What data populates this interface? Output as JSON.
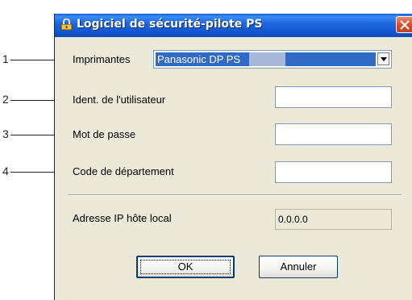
{
  "window": {
    "title": "Logiciel de sécurité-pilote PS"
  },
  "callouts": [
    "1",
    "2",
    "3",
    "4"
  ],
  "form": {
    "printers_label": "Imprimantes",
    "printer_value": "Panasonic DP          PS",
    "user_id_label": "Ident. de l'utilisateur",
    "user_id_value": "",
    "password_label": "Mot de passe",
    "password_value": "",
    "department_label": "Code de département",
    "department_value": "",
    "local_ip_label": "Adresse IP hôte local",
    "local_ip_value": "0.0.0.0"
  },
  "buttons": {
    "ok": "OK",
    "cancel": "Annuler"
  },
  "colors": {
    "titlebar": "#2168e0",
    "dialog_bg": "#ece9d8",
    "selection": "#316ac5",
    "close_button": "#d8532d"
  },
  "icons": {
    "title": "lock-printer-icon",
    "close": "close-icon",
    "dropdown": "chevron-down-icon"
  }
}
